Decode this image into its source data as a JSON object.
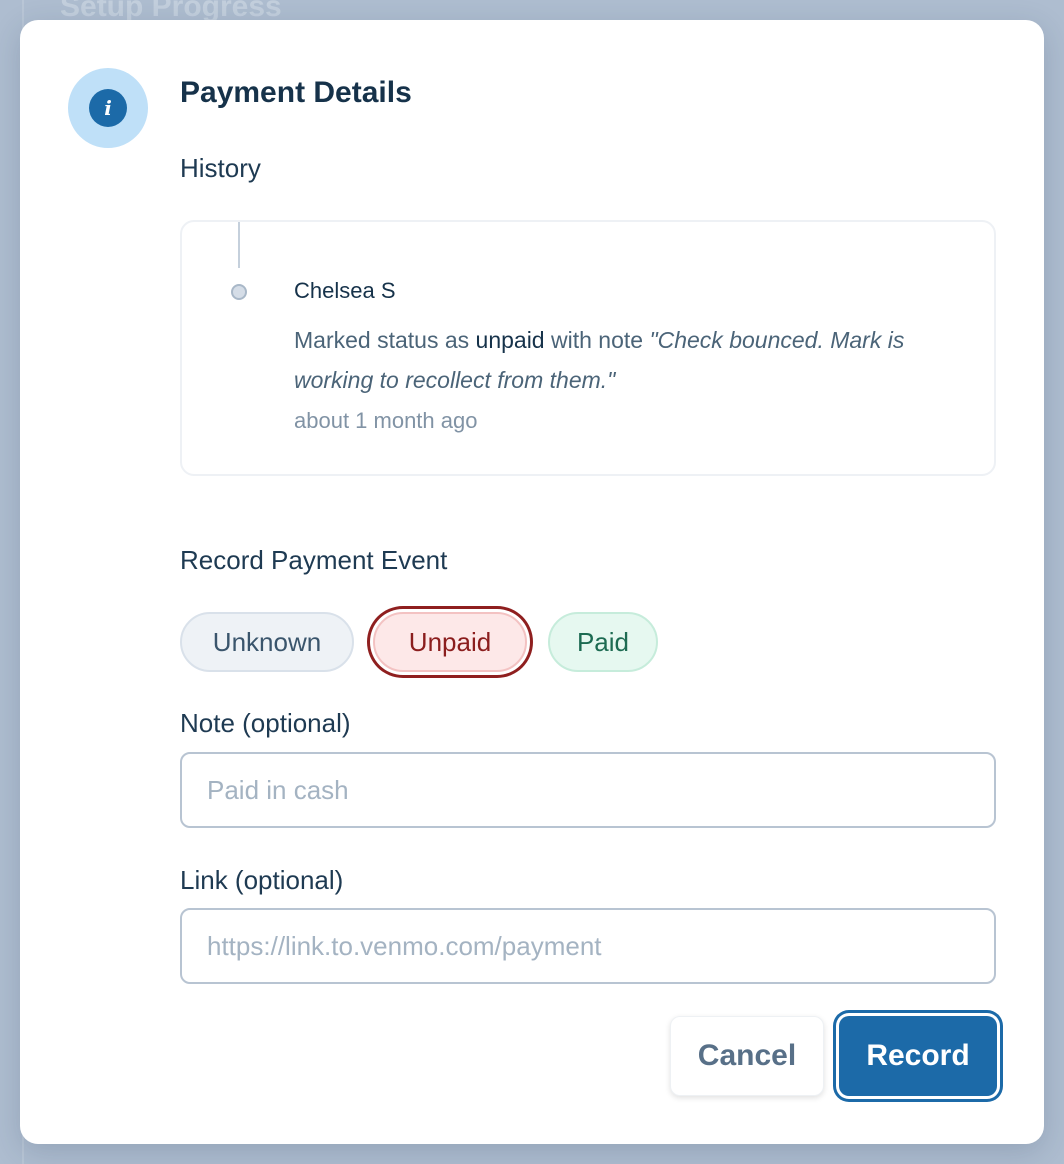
{
  "background": {
    "heading": "Setup Progress"
  },
  "modal": {
    "title": "Payment Details",
    "history": {
      "heading": "History",
      "events": [
        {
          "user": "Chelsea S",
          "prefix": "Marked status as ",
          "status": "unpaid",
          "middle": " with note ",
          "note": "\"Check bounced. Mark is working to recollect from them.\"",
          "time": "about 1 month ago"
        }
      ]
    },
    "record": {
      "heading": "Record Payment Event",
      "statuses": {
        "unknown": "Unknown",
        "unpaid": "Unpaid",
        "paid": "Paid"
      },
      "selected_status": "Unpaid"
    },
    "note_field": {
      "label": "Note (optional)",
      "value": "",
      "placeholder": "Paid in cash"
    },
    "link_field": {
      "label": "Link (optional)",
      "value": "",
      "placeholder": "https://link.to.venmo.com/payment"
    },
    "buttons": {
      "cancel": "Cancel",
      "record": "Record"
    }
  },
  "colors": {
    "accent": "#1c6aa8",
    "unpaid": "#8b1d1d",
    "paid": "#1d6b52",
    "info_icon_bg": "#bfe0f8"
  },
  "icons": {
    "header": "info-icon"
  }
}
